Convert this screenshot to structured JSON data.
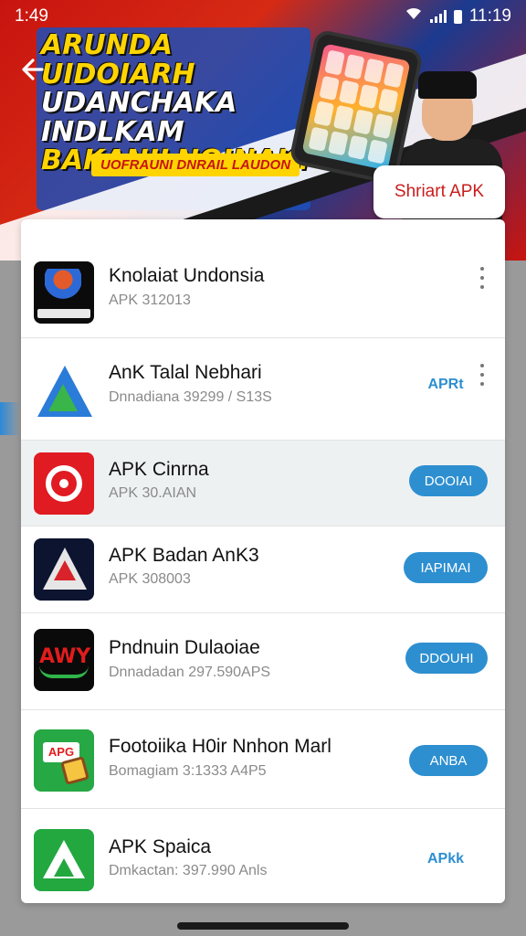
{
  "status_bar": {
    "time": "1:49",
    "right_text": "11:19"
  },
  "banner": {
    "headline_1": "ARUNDA UIDOIARH",
    "headline_2": "UDANCHAKA INDLKAM",
    "headline_3": "BAKANILNOINAK!",
    "subtitle": "UOFRAUNI DNRAIL LAUDON",
    "start_button": "Shriart APK"
  },
  "apps": [
    {
      "title": "Knolaiat Undonsia",
      "subtitle": "APK 312013",
      "action": ""
    },
    {
      "title": "AnK Talal Nebhari",
      "subtitle": "Dnnadiana 39299 / S13S",
      "action": "APRt"
    },
    {
      "title": "APK Cinrna",
      "subtitle": "APK 30.AIAN",
      "action": "DOOIAI"
    },
    {
      "title": "APK Badan AnK3",
      "subtitle": "APK 308003",
      "action": "IAPIMAI"
    },
    {
      "title": "Pndnuin Dulaoiae",
      "subtitle": "Dnnadadan 297.590APS",
      "action": "DDOUHI"
    },
    {
      "title": "Footoiika H0ir Nnhon Marl",
      "subtitle": "Bomagiam 3:1333 A4P5",
      "action": "ANBA"
    },
    {
      "title": "APK Spaica",
      "subtitle": "Dmkactan: 397.990 Anls",
      "action": "APkk"
    }
  ],
  "icons": {
    "back": "back-arrow-icon",
    "more": "more-vert-icon",
    "wifi": "wifi-icon",
    "signal": "signal-icon",
    "battery": "battery-icon"
  },
  "colors": {
    "accent": "#2d8fd0",
    "brand_red": "#c81d1d"
  }
}
